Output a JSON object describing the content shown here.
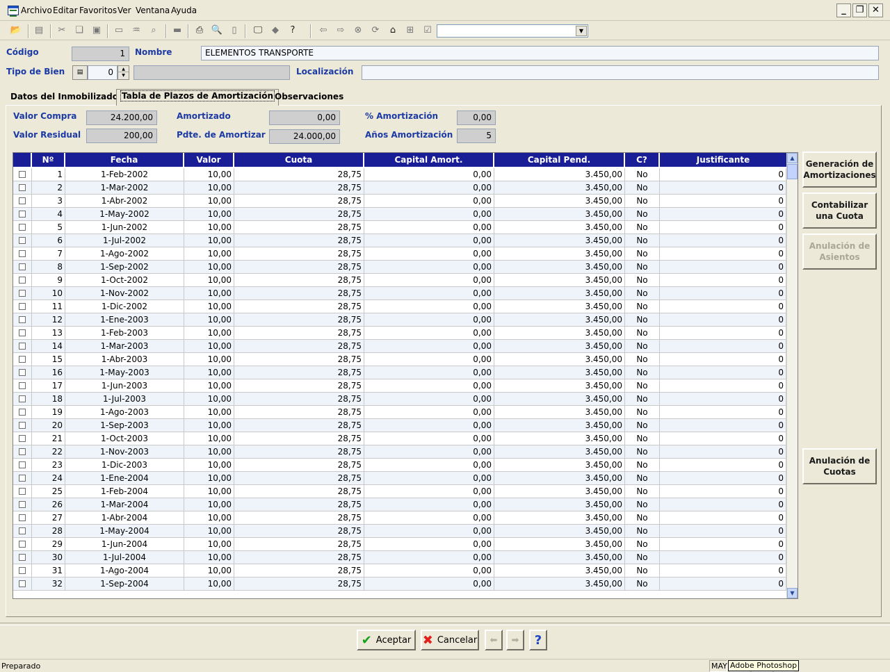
{
  "menu": [
    "Archivo",
    "Editar",
    "Favoritos",
    "Ver",
    "Ventana",
    "Ayuda"
  ],
  "header": {
    "codigo_label": "Código",
    "codigo_value": "1",
    "nombre_label": "Nombre",
    "nombre_value": "ELEMENTOS TRANSPORTE",
    "tipo_label": "Tipo de Bien",
    "tipo_value": "0",
    "localizacion_label": "Localización"
  },
  "tabs": [
    "Datos del Inmobilizado",
    "Tabla de Plazos de Amortización",
    "Observaciones"
  ],
  "summary": {
    "valor_compra_label": "Valor Compra",
    "valor_compra": "24.200,00",
    "valor_residual_label": "Valor Residual",
    "valor_residual": "200,00",
    "amortizado_label": "Amortizado",
    "amortizado": "0,00",
    "pdte_label": "Pdte. de Amortizar",
    "pdte": "24.000,00",
    "pct_label": "% Amortización",
    "pct": "0,00",
    "anos_label": "Años Amortización",
    "anos": "5"
  },
  "grid": {
    "columns": [
      "",
      "Nº",
      "Fecha",
      "Valor",
      "Cuota",
      "Capital Amort.",
      "Capital Pend.",
      "C?",
      "Justificante"
    ],
    "rows": [
      [
        "1",
        "1-Feb-2002",
        "10,00",
        "28,75",
        "0,00",
        "3.450,00",
        "No",
        "0"
      ],
      [
        "2",
        "1-Mar-2002",
        "10,00",
        "28,75",
        "0,00",
        "3.450,00",
        "No",
        "0"
      ],
      [
        "3",
        "1-Abr-2002",
        "10,00",
        "28,75",
        "0,00",
        "3.450,00",
        "No",
        "0"
      ],
      [
        "4",
        "1-May-2002",
        "10,00",
        "28,75",
        "0,00",
        "3.450,00",
        "No",
        "0"
      ],
      [
        "5",
        "1-Jun-2002",
        "10,00",
        "28,75",
        "0,00",
        "3.450,00",
        "No",
        "0"
      ],
      [
        "6",
        "1-Jul-2002",
        "10,00",
        "28,75",
        "0,00",
        "3.450,00",
        "No",
        "0"
      ],
      [
        "7",
        "1-Ago-2002",
        "10,00",
        "28,75",
        "0,00",
        "3.450,00",
        "No",
        "0"
      ],
      [
        "8",
        "1-Sep-2002",
        "10,00",
        "28,75",
        "0,00",
        "3.450,00",
        "No",
        "0"
      ],
      [
        "9",
        "1-Oct-2002",
        "10,00",
        "28,75",
        "0,00",
        "3.450,00",
        "No",
        "0"
      ],
      [
        "10",
        "1-Nov-2002",
        "10,00",
        "28,75",
        "0,00",
        "3.450,00",
        "No",
        "0"
      ],
      [
        "11",
        "1-Dic-2002",
        "10,00",
        "28,75",
        "0,00",
        "3.450,00",
        "No",
        "0"
      ],
      [
        "12",
        "1-Ene-2003",
        "10,00",
        "28,75",
        "0,00",
        "3.450,00",
        "No",
        "0"
      ],
      [
        "13",
        "1-Feb-2003",
        "10,00",
        "28,75",
        "0,00",
        "3.450,00",
        "No",
        "0"
      ],
      [
        "14",
        "1-Mar-2003",
        "10,00",
        "28,75",
        "0,00",
        "3.450,00",
        "No",
        "0"
      ],
      [
        "15",
        "1-Abr-2003",
        "10,00",
        "28,75",
        "0,00",
        "3.450,00",
        "No",
        "0"
      ],
      [
        "16",
        "1-May-2003",
        "10,00",
        "28,75",
        "0,00",
        "3.450,00",
        "No",
        "0"
      ],
      [
        "17",
        "1-Jun-2003",
        "10,00",
        "28,75",
        "0,00",
        "3.450,00",
        "No",
        "0"
      ],
      [
        "18",
        "1-Jul-2003",
        "10,00",
        "28,75",
        "0,00",
        "3.450,00",
        "No",
        "0"
      ],
      [
        "19",
        "1-Ago-2003",
        "10,00",
        "28,75",
        "0,00",
        "3.450,00",
        "No",
        "0"
      ],
      [
        "20",
        "1-Sep-2003",
        "10,00",
        "28,75",
        "0,00",
        "3.450,00",
        "No",
        "0"
      ],
      [
        "21",
        "1-Oct-2003",
        "10,00",
        "28,75",
        "0,00",
        "3.450,00",
        "No",
        "0"
      ],
      [
        "22",
        "1-Nov-2003",
        "10,00",
        "28,75",
        "0,00",
        "3.450,00",
        "No",
        "0"
      ],
      [
        "23",
        "1-Dic-2003",
        "10,00",
        "28,75",
        "0,00",
        "3.450,00",
        "No",
        "0"
      ],
      [
        "24",
        "1-Ene-2004",
        "10,00",
        "28,75",
        "0,00",
        "3.450,00",
        "No",
        "0"
      ],
      [
        "25",
        "1-Feb-2004",
        "10,00",
        "28,75",
        "0,00",
        "3.450,00",
        "No",
        "0"
      ],
      [
        "26",
        "1-Mar-2004",
        "10,00",
        "28,75",
        "0,00",
        "3.450,00",
        "No",
        "0"
      ],
      [
        "27",
        "1-Abr-2004",
        "10,00",
        "28,75",
        "0,00",
        "3.450,00",
        "No",
        "0"
      ],
      [
        "28",
        "1-May-2004",
        "10,00",
        "28,75",
        "0,00",
        "3.450,00",
        "No",
        "0"
      ],
      [
        "29",
        "1-Jun-2004",
        "10,00",
        "28,75",
        "0,00",
        "3.450,00",
        "No",
        "0"
      ],
      [
        "30",
        "1-Jul-2004",
        "10,00",
        "28,75",
        "0,00",
        "3.450,00",
        "No",
        "0"
      ],
      [
        "31",
        "1-Ago-2004",
        "10,00",
        "28,75",
        "0,00",
        "3.450,00",
        "No",
        "0"
      ],
      [
        "32",
        "1-Sep-2004",
        "10,00",
        "28,75",
        "0,00",
        "3.450,00",
        "No",
        "0"
      ]
    ]
  },
  "side_buttons": [
    {
      "label": "Generación de Amortizaciones",
      "enabled": true
    },
    {
      "label": "Contabilizar una Cuota",
      "enabled": true
    },
    {
      "label": "Anulación de Asientos",
      "enabled": false
    },
    {
      "label": "Anulación de Cuotas",
      "enabled": true
    }
  ],
  "bottom_buttons": {
    "accept": "Aceptar",
    "cancel": "Cancelar"
  },
  "status": {
    "text": "Preparado",
    "caps": "MAY",
    "tooltip": "Adobe Photoshop"
  },
  "colors": {
    "grid_header": "#1a1e96",
    "label_blue": "#1c3aa5",
    "accept_icon": "#16a21a",
    "cancel_icon": "#e0201a"
  }
}
